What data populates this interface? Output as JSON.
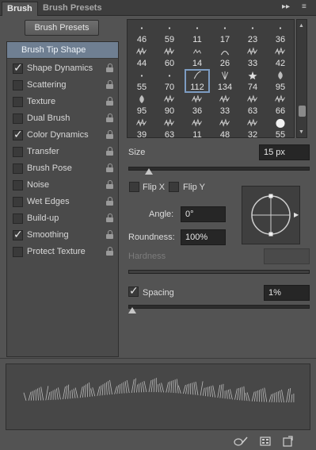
{
  "tabs": [
    {
      "label": "Brush",
      "active": true
    },
    {
      "label": "Brush Presets",
      "active": false
    }
  ],
  "tabbar_controls": {
    "collapse": "▸▸",
    "close": "✕",
    "menu": "≡"
  },
  "brush_presets_button": "Brush Presets",
  "brush_tip_shape": "Brush Tip Shape",
  "options": [
    {
      "label": "Shape Dynamics",
      "checked": true
    },
    {
      "label": "Scattering",
      "checked": false
    },
    {
      "label": "Texture",
      "checked": false
    },
    {
      "label": "Dual Brush",
      "checked": false
    },
    {
      "label": "Color Dynamics",
      "checked": true
    },
    {
      "label": "Transfer",
      "checked": false
    },
    {
      "label": "Brush Pose",
      "checked": false
    },
    {
      "label": "Noise",
      "checked": false
    },
    {
      "label": "Wet Edges",
      "checked": false
    },
    {
      "label": "Build-up",
      "checked": false
    },
    {
      "label": "Smoothing",
      "checked": true
    },
    {
      "label": "Protect Texture",
      "checked": false
    }
  ],
  "brush_grid": {
    "rows": [
      [
        "46",
        "59",
        "11",
        "17",
        "23",
        "36"
      ],
      [
        "44",
        "60",
        "14",
        "26",
        "33",
        "42"
      ],
      [
        "55",
        "70",
        "112",
        "134",
        "74",
        "95"
      ],
      [
        "95",
        "90",
        "36",
        "33",
        "63",
        "66"
      ],
      [
        "39",
        "63",
        "11",
        "48",
        "32",
        "55"
      ]
    ],
    "selected": "112"
  },
  "size": {
    "label": "Size",
    "value": "15 px",
    "slider_fraction": 0.06
  },
  "flip_x": {
    "label": "Flip X",
    "checked": false
  },
  "flip_y": {
    "label": "Flip Y",
    "checked": false
  },
  "angle": {
    "label": "Angle:",
    "value": "0°"
  },
  "roundness": {
    "label": "Roundness:",
    "value": "100%"
  },
  "hardness": {
    "label": "Hardness",
    "value": ""
  },
  "spacing": {
    "label": "Spacing",
    "checked": true,
    "value": "1%",
    "slider_fraction": 0.0
  },
  "colors": {
    "accent": "#7d9cc2",
    "panel": "#535353",
    "field": "#262626"
  }
}
